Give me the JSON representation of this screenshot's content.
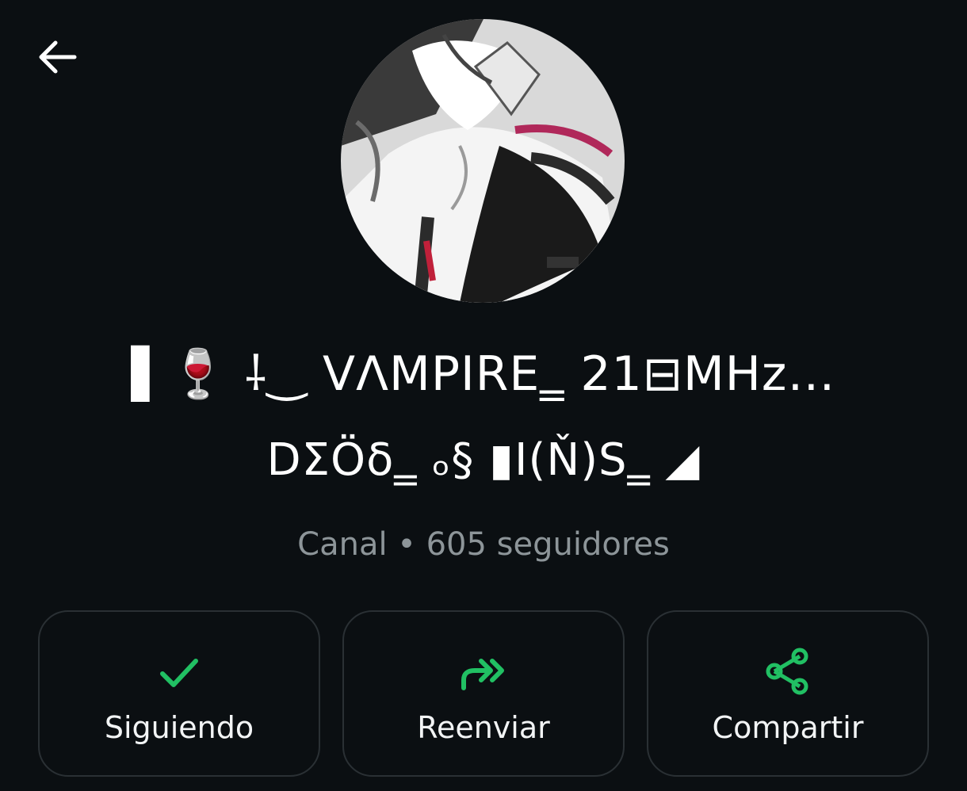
{
  "header": {
    "back_icon": "arrow-left-icon"
  },
  "channel": {
    "avatar": "anime-vampire-avatar",
    "name_line1": "▌🍷     ⸸‿   VΛMPIRE‗    21⊟MHz…",
    "name_line2": "DΣÖδ‗ ₒ§  ▮I(Ň)S‗ ◢",
    "meta": "Canal • 605 seguidores"
  },
  "actions": [
    {
      "label": "Siguiendo",
      "icon": "checkmark-icon"
    },
    {
      "label": "Reenviar",
      "icon": "forward-icon"
    },
    {
      "label": "Compartir",
      "icon": "share-icon"
    }
  ],
  "colors": {
    "background": "#0b0f12",
    "accent": "#21c063",
    "muted_text": "#8d9599",
    "button_border": "#2a3034"
  }
}
